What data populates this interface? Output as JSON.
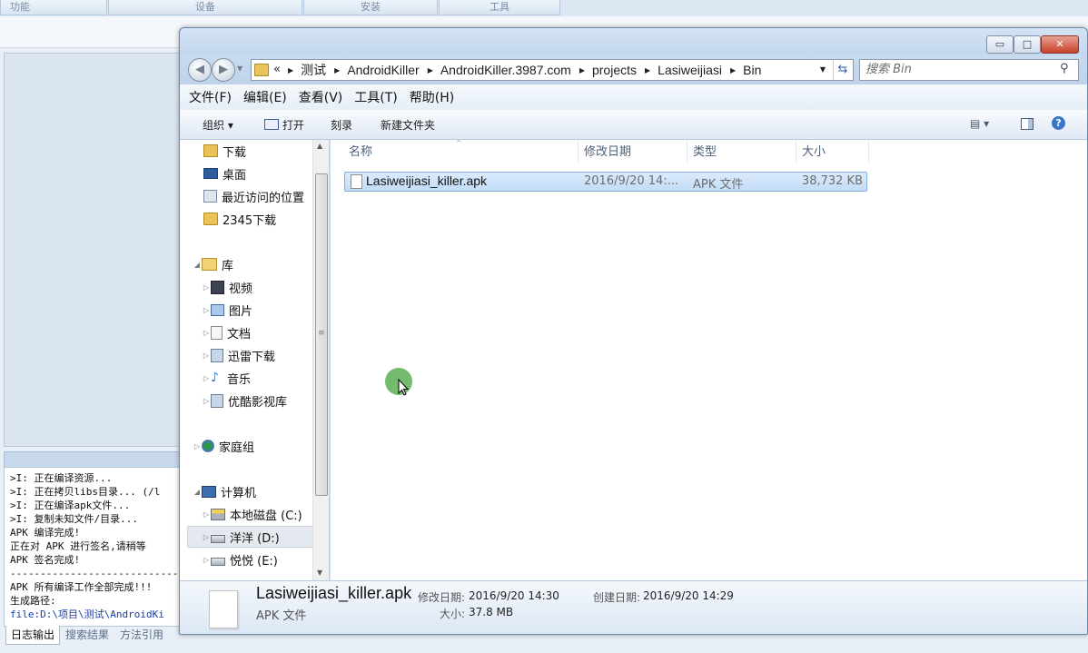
{
  "background_app": {
    "tabs": [
      "功能",
      "设备",
      "安装",
      "工具"
    ],
    "log_lines": [
      ">I: 正在编译资源...",
      ">I: 正在拷贝libs目录... (/l",
      ">I: 正在编译apk文件...",
      ">I: 复制未知文件/目录...",
      "APK 编译完成!",
      "正在对 APK 进行签名,请稍等",
      "APK 签名完成!",
      "----------------------------",
      "APK 所有编译工作全部完成!!!",
      "生成路径:"
    ],
    "log_path_link": "file:D:\\项目\\测试\\AndroidKi",
    "bottom_tabs": [
      "日志输出",
      "搜索结果",
      "方法引用"
    ]
  },
  "explorer": {
    "window_buttons": {
      "minimize": "▭",
      "maximize": "□",
      "close": "✕"
    },
    "address": {
      "overflow": "«",
      "crumbs": [
        "测试",
        "AndroidKiller",
        "AndroidKiller.3987.com",
        "projects",
        "Lasiweijiasi",
        "Bin"
      ]
    },
    "search": {
      "placeholder": "搜索 Bin"
    },
    "menu": [
      "文件(F)",
      "编辑(E)",
      "查看(V)",
      "工具(T)",
      "帮助(H)"
    ],
    "toolbar": {
      "organize": "组织 ▾",
      "open": "打开",
      "burn": "刻录",
      "new_folder": "新建文件夹",
      "views": "▤ ▾",
      "help": "?"
    },
    "nav_pane": {
      "favorites": [
        "下载",
        "桌面",
        "最近访问的位置",
        "2345下载"
      ],
      "library": "库",
      "library_items": [
        "视频",
        "图片",
        "文档",
        "迅雷下载",
        "音乐",
        "优酷影视库"
      ],
      "homegroup": "家庭组",
      "computer": "计算机",
      "drives": [
        "本地磁盘 (C:)",
        "洋洋 (D:)",
        "悦悦 (E:)"
      ]
    },
    "columns": {
      "name": "名称",
      "date": "修改日期",
      "type": "类型",
      "size": "大小"
    },
    "files": [
      {
        "name": "Lasiweijiasi_killer.apk",
        "date": "2016/9/20 14:...",
        "type": "APK 文件",
        "size": "38,732 KB"
      }
    ],
    "details": {
      "name": "Lasiweijiasi_killer.apk",
      "type": "APK 文件",
      "modified_label": "修改日期:",
      "modified_value": "2016/9/20 14:30",
      "created_label": "创建日期:",
      "created_value": "2016/9/20 14:29",
      "size_label": "大小:",
      "size_value": "37.8 MB"
    }
  }
}
